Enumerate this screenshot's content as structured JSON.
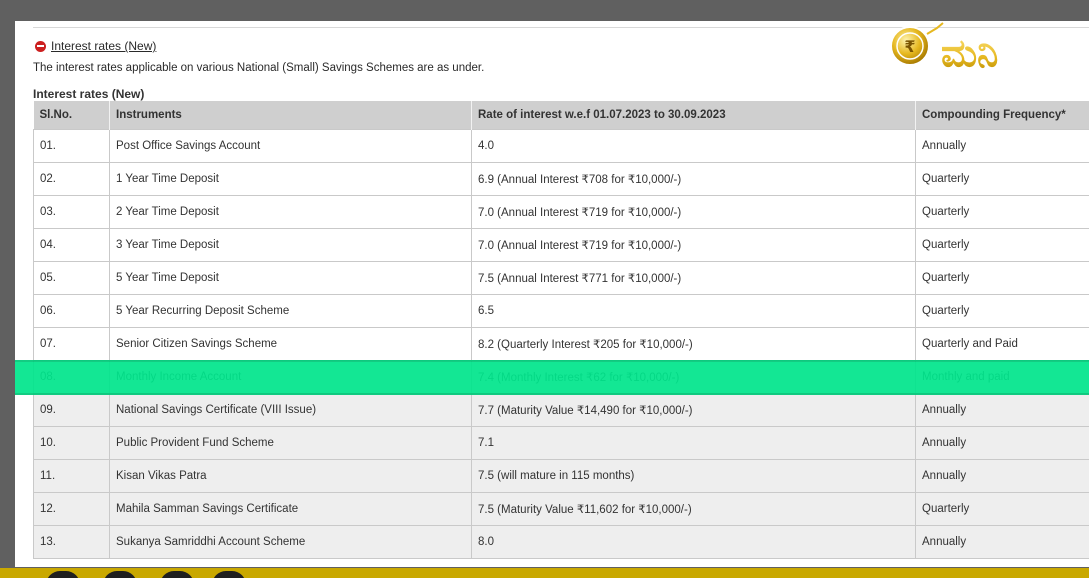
{
  "section": {
    "link_label": "Interest rates (New)",
    "intro": "The interest rates applicable on various National (Small) Savings Schemes are as under.",
    "caption": "Interest rates (New)"
  },
  "logo": {
    "glyph": "₹",
    "text": "ಮನಿ"
  },
  "table": {
    "headers": [
      "Sl.No.",
      "Instruments",
      "Rate of interest w.e.f 01.07.2023 to 30.09.2023",
      "Compounding Frequency*"
    ],
    "rows": [
      {
        "no": "01.",
        "instrument": "Post Office Savings Account",
        "rate": "4.0",
        "frequency": "Annually"
      },
      {
        "no": "02.",
        "instrument": "1 Year Time Deposit",
        "rate": "6.9 (Annual Interest ₹708 for ₹10,000/-)",
        "frequency": "Quarterly"
      },
      {
        "no": "03.",
        "instrument": "2 Year Time Deposit",
        "rate": "7.0 (Annual Interest ₹719 for ₹10,000/-)",
        "frequency": "Quarterly"
      },
      {
        "no": "04.",
        "instrument": "3 Year Time Deposit",
        "rate": "7.0 (Annual Interest ₹719 for ₹10,000/-)",
        "frequency": "Quarterly"
      },
      {
        "no": "05.",
        "instrument": "5 Year Time Deposit",
        "rate": "7.5 (Annual Interest ₹771 for ₹10,000/-)",
        "frequency": "Quarterly"
      },
      {
        "no": "06.",
        "instrument": "5 Year Recurring Deposit Scheme",
        "rate": "6.5",
        "frequency": "Quarterly"
      },
      {
        "no": "07.",
        "instrument": "Senior Citizen Savings Scheme",
        "rate": "8.2 (Quarterly Interest ₹205 for ₹10,000/-)",
        "frequency": "Quarterly and Paid"
      },
      {
        "no": "08.",
        "instrument": "Monthly Income Account",
        "rate": "7.4 (Monthly Interest ₹62 for ₹10,000/-)",
        "frequency": "Monthly and paid"
      },
      {
        "no": "09.",
        "instrument": "National Savings Certificate (VIII Issue)",
        "rate": "7.7 (Maturity Value ₹14,490 for ₹10,000/-)",
        "frequency": "Annually"
      },
      {
        "no": "10.",
        "instrument": "Public Provident Fund Scheme",
        "rate": "7.1",
        "frequency": "Annually"
      },
      {
        "no": "11.",
        "instrument": "Kisan Vikas Patra",
        "rate": "7.5 (will mature in 115 months)",
        "frequency": "Annually"
      },
      {
        "no": "12.",
        "instrument": "Mahila Samman Savings Certificate",
        "rate": "7.5 (Maturity Value ₹11,602 for ₹10,000/-)",
        "frequency": "Quarterly"
      },
      {
        "no": "13.",
        "instrument": "Sukanya Samriddhi Account Scheme",
        "rate": "8.0",
        "frequency": "Annually"
      }
    ],
    "highlighted_row": 7
  },
  "colors": {
    "highlight": "#00e68c",
    "header_bg": "#cfcfcf",
    "logo_gold": "#e6b820",
    "bottom_bar": "#c9a800",
    "minus_icon": "#cc1f1f"
  }
}
